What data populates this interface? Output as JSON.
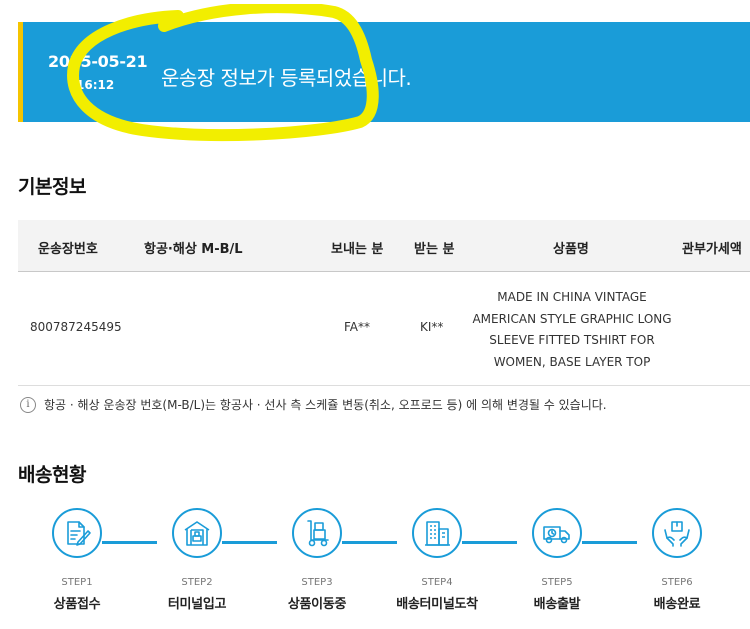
{
  "banner": {
    "date": "2025-05-21",
    "time": "16:12",
    "message": "운송장 정보가 등록되었습니다.",
    "background_color": "#1a9cd8",
    "accent_color": "#f5c400",
    "annotation_color": "#f2ee00"
  },
  "basic_info": {
    "title": "기본정보",
    "columns": [
      "운송장번호",
      "항공·해상 M-B/L",
      "보내는 분",
      "받는 분",
      "상품명",
      "관부가세액"
    ],
    "row": {
      "tracking_number": "800787245495",
      "mbl": "",
      "sender": "FA**",
      "receiver": "KI**",
      "product_lines": [
        "MADE IN CHINA VINTAGE",
        "AMERICAN STYLE GRAPHIC LONG",
        "SLEEVE FITTED TSHIRT FOR",
        "WOMEN, BASE LAYER TOP"
      ],
      "customs_tax": ""
    },
    "note_icon": "info-icon",
    "note": "항공 · 해상 운송장 번호(M-B/L)는 항공사 · 선사 측 스케쥴 변동(취소, 오프로드 등) 에 의해 변경될 수 있습니다."
  },
  "delivery_status": {
    "title": "배송현황",
    "steps": [
      {
        "num": "STEP1",
        "label": "상품접수",
        "icon": "document-pen-icon"
      },
      {
        "num": "STEP2",
        "label": "터미널입고",
        "icon": "warehouse-icon"
      },
      {
        "num": "STEP3",
        "label": "상품이동중",
        "icon": "hand-truck-icon"
      },
      {
        "num": "STEP4",
        "label": "배송터미널도착",
        "icon": "building-icon"
      },
      {
        "num": "STEP5",
        "label": "배송출발",
        "icon": "delivery-truck-icon"
      },
      {
        "num": "STEP6",
        "label": "배송완료",
        "icon": "package-hands-icon"
      }
    ]
  }
}
